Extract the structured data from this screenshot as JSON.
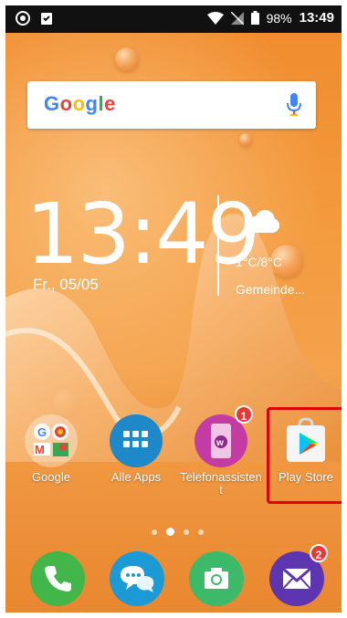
{
  "statusbar": {
    "battery": "98%",
    "time": "13:49"
  },
  "search": {
    "logo_letters": [
      "G",
      "o",
      "o",
      "g",
      "l",
      "e"
    ]
  },
  "clock_widget": {
    "time": "13:49",
    "date": "Fr., 05/05",
    "temperature": "1°C/8°C",
    "location": "Gemeinde..."
  },
  "apps": [
    {
      "label": "Google",
      "badge": ""
    },
    {
      "label": "Alle Apps",
      "badge": ""
    },
    {
      "label": "Telefonassistent",
      "badge": "1"
    },
    {
      "label": "Play Store",
      "badge": ""
    }
  ],
  "dock": {
    "messages_badge": "2"
  },
  "page_indicator": {
    "count": 4,
    "active": 1
  }
}
